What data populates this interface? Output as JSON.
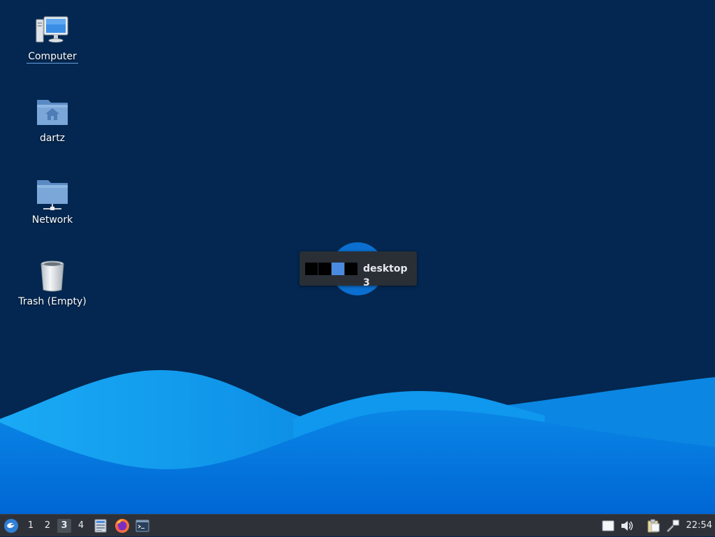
{
  "desktop": {
    "icons": [
      {
        "label": "Computer",
        "icon": "computer-icon"
      },
      {
        "label": "dartz",
        "icon": "home-folder-icon"
      },
      {
        "label": "Network",
        "icon": "network-folder-icon"
      },
      {
        "label": "Trash (Empty)",
        "icon": "trash-icon"
      }
    ]
  },
  "osd": {
    "text": "desktop 3",
    "pager_cells": 4,
    "current_desktop": 3
  },
  "taskbar": {
    "start_icon": "lxqt-menu-icon",
    "workspaces": [
      "1",
      "2",
      "3",
      "4"
    ],
    "active_workspace": "3",
    "launchers": [
      "file-manager-icon",
      "firefox-icon",
      "terminal-icon"
    ],
    "tray_icons": [
      "notes-icon",
      "volume-icon",
      "clipboard-icon",
      "network-tool-icon"
    ],
    "clock": "22:54"
  },
  "colors": {
    "desktop_bg": "#032750",
    "wave_light": "#17a8f5",
    "wave_mid": "#0a8fe8",
    "wave_dark": "#0073d9",
    "taskbar_bg": "#2e3238",
    "accent": "#4a8be0"
  }
}
